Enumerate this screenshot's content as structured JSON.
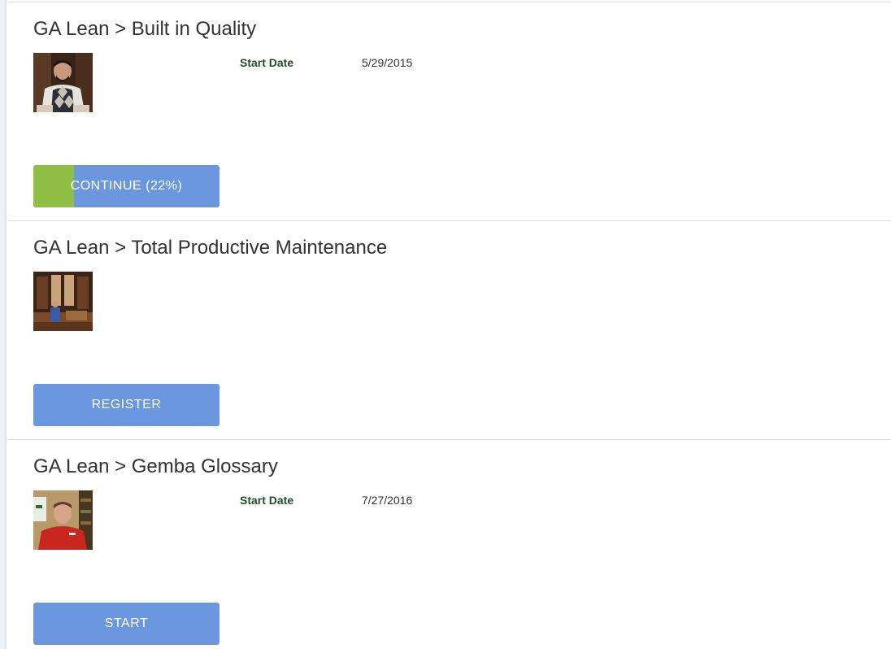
{
  "courses": [
    {
      "title": "GA Lean > Built in Quality",
      "start_date_label": "Start Date",
      "start_date": "5/29/2015",
      "button_label": "CONTINUE (22%)",
      "progress_percent": 22,
      "thumbnail": "presenter-argyle-sweater-icon"
    },
    {
      "title": "GA Lean > Total Productive Maintenance",
      "button_label": "REGISTER",
      "thumbnail": "lecture-hall-speaker-icon"
    },
    {
      "title": "GA Lean > Gemba Glossary",
      "start_date_label": "Start Date",
      "start_date": "7/27/2016",
      "button_label": "START",
      "thumbnail": "presenter-red-shirt-icon"
    }
  ],
  "colors": {
    "button_blue": "#6b97df",
    "progress_green": "#8fbf45",
    "start_date_label": "#1f4d2c"
  }
}
